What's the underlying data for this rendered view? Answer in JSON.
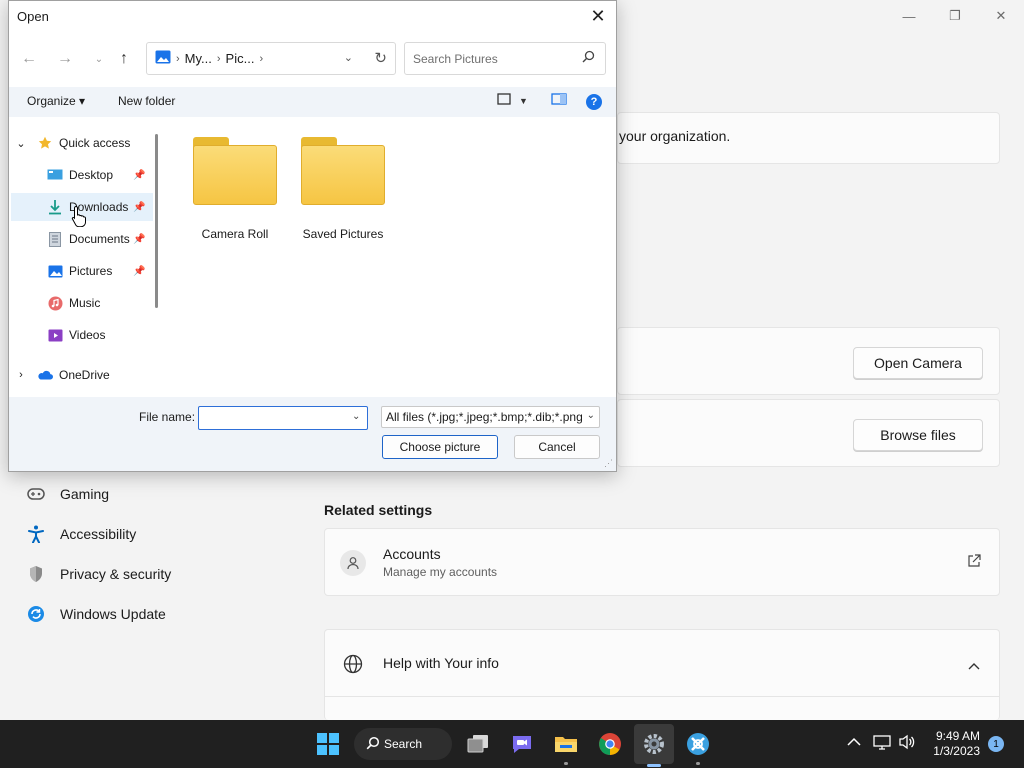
{
  "settings": {
    "window_controls": [
      "—",
      "❐",
      "✕"
    ],
    "org_text": "your organization.",
    "open_camera": "Open Camera",
    "browse_files": "Browse files",
    "related_settings": "Related settings",
    "accounts_title": "Accounts",
    "accounts_sub": "Manage my accounts",
    "help_title": "Help with Your info",
    "nav": [
      {
        "label": "Gaming",
        "icon": "gamepad-icon"
      },
      {
        "label": "Accessibility",
        "icon": "accessibility-icon"
      },
      {
        "label": "Privacy & security",
        "icon": "shield-icon"
      },
      {
        "label": "Windows Update",
        "icon": "update-icon"
      }
    ]
  },
  "dialog": {
    "title": "Open",
    "breadcrumb": [
      "My...",
      "Pic..."
    ],
    "search_placeholder": "Search Pictures",
    "organize": "Organize",
    "new_folder": "New folder",
    "tree": [
      {
        "label": "Quick access",
        "icon": "star-icon",
        "expanded": true
      },
      {
        "label": "Desktop",
        "icon": "desktop-icon",
        "pinned": true
      },
      {
        "label": "Downloads",
        "icon": "download-icon",
        "pinned": true,
        "selected": true
      },
      {
        "label": "Documents",
        "icon": "document-icon",
        "pinned": true
      },
      {
        "label": "Pictures",
        "icon": "pictures-icon",
        "pinned": true
      },
      {
        "label": "Music",
        "icon": "music-icon"
      },
      {
        "label": "Videos",
        "icon": "video-icon"
      },
      {
        "label": "OneDrive",
        "icon": "cloud-icon",
        "expanded": false
      }
    ],
    "folders": [
      "Camera Roll",
      "Saved Pictures"
    ],
    "file_name_label": "File name:",
    "file_name_value": "",
    "file_type": "All files (*.jpg;*.jpeg;*.bmp;*.dib;*.png",
    "choose_button": "Choose picture",
    "cancel_button": "Cancel"
  },
  "taskbar": {
    "search_label": "Search",
    "time": "9:49 AM",
    "date": "1/3/2023",
    "notifications": "1"
  },
  "colors": {
    "accent": "#1e64c8",
    "taskbar_bg": "#202020",
    "folder": "#f6c543"
  }
}
